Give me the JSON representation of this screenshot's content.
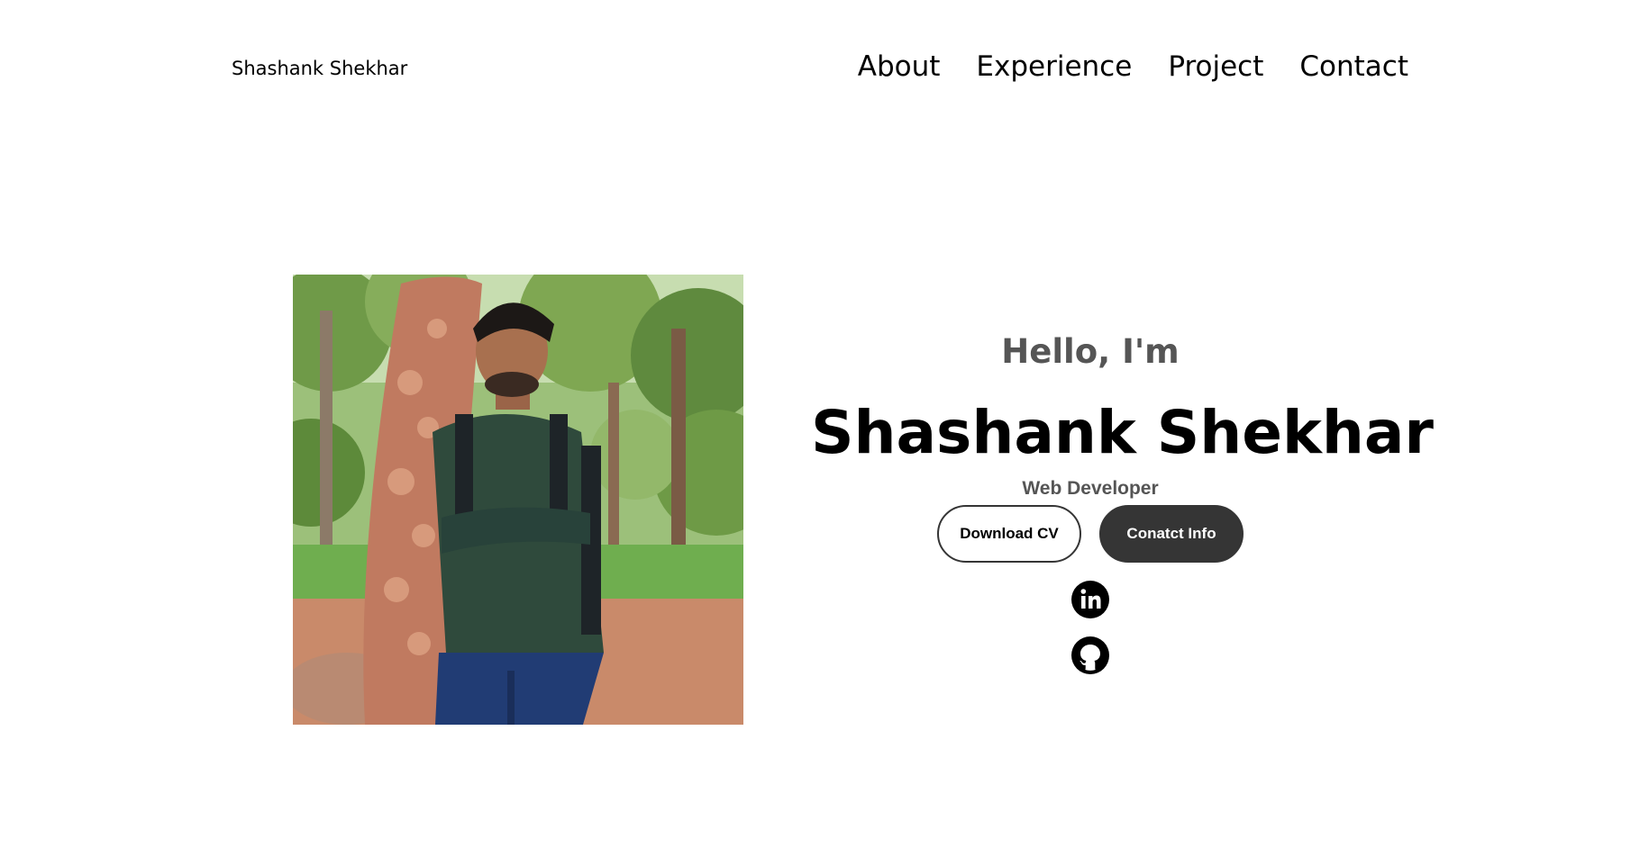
{
  "nav": {
    "logo": "Shashank Shekhar",
    "links": [
      "About",
      "Experience",
      "Project",
      "Contact"
    ]
  },
  "hero": {
    "greeting": "Hello, I'm",
    "name": "Shashank Shekhar",
    "role": "Web Developer",
    "download_label": "Download CV",
    "contact_label": "Conatct Info"
  },
  "socials": {
    "linkedin_icon": "linkedin-icon",
    "github_icon": "github-icon"
  },
  "colors": {
    "text": "#000000",
    "muted": "#555555",
    "button_dark": "#353535",
    "background": "#ffffff"
  }
}
